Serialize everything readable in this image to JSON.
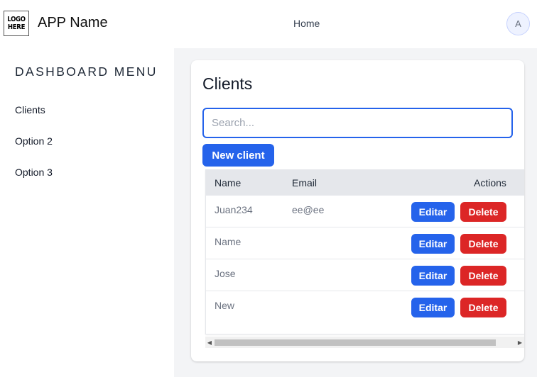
{
  "header": {
    "logo_line1": "LOGO",
    "logo_line2": "HERE",
    "app_name": "APP Name",
    "nav": [
      {
        "label": "Home"
      }
    ],
    "avatar_initial": "A"
  },
  "sidebar": {
    "title": "DASHBOARD MENU",
    "items": [
      {
        "label": "Clients"
      },
      {
        "label": "Option 2"
      },
      {
        "label": "Option 3"
      }
    ]
  },
  "clients": {
    "title": "Clients",
    "search_placeholder": "Search...",
    "new_button": "New client",
    "columns": [
      "Name",
      "Email",
      "Actions"
    ],
    "rows": [
      {
        "name": "Juan234",
        "email": "ee@ee"
      },
      {
        "name": "Name",
        "email": ""
      },
      {
        "name": "Jose",
        "email": ""
      },
      {
        "name": "New",
        "email": ""
      }
    ],
    "edit_label": "Editar",
    "delete_label": "Delete"
  },
  "colors": {
    "primary": "#2563eb",
    "danger": "#dc2626",
    "main_bg": "#f3f4f6",
    "table_header_bg": "#e5e7eb"
  }
}
